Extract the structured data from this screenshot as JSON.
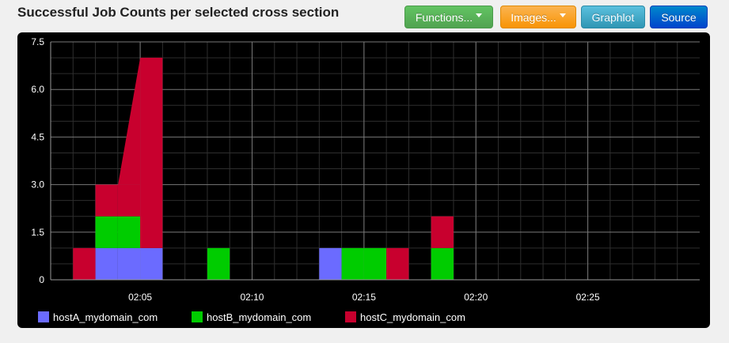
{
  "title": "Successful Job Counts per selected cross section",
  "toolbar": {
    "functions_label": "Functions...",
    "images_label": "Images...",
    "graphlot_label": "Graphlot",
    "source_label": "Source"
  },
  "chart_data": {
    "type": "area",
    "stacked": true,
    "x_unit": "time (minute buckets)",
    "x": [
      "02:02",
      "02:03",
      "02:04",
      "02:05",
      "02:06",
      "02:07",
      "02:08",
      "02:09",
      "02:10",
      "02:11",
      "02:12",
      "02:13",
      "02:14",
      "02:15",
      "02:16",
      "02:17",
      "02:18",
      "02:19"
    ],
    "series": [
      {
        "name": "hostA_mydomain_com",
        "color": "#6b6bff",
        "values": [
          0,
          1,
          1,
          1,
          0,
          0,
          0,
          0,
          0,
          0,
          0,
          1,
          0,
          0,
          0,
          0,
          0,
          0
        ]
      },
      {
        "name": "hostB_mydomain_com",
        "color": "#00cc00",
        "values": [
          0,
          1,
          1,
          0,
          0,
          0,
          1,
          0,
          0,
          0,
          0,
          0,
          1,
          1,
          0,
          0,
          1,
          0
        ]
      },
      {
        "name": "hostC_mydomain_com",
        "color": "#c8002e",
        "values": [
          1,
          1,
          1,
          6,
          0,
          0,
          0,
          0,
          0,
          0,
          0,
          0,
          0,
          0,
          1,
          0,
          1,
          0
        ]
      }
    ],
    "y_ticks": [
      "0",
      "1.5",
      "3.0",
      "4.5",
      "6.0",
      "7.5"
    ],
    "x_ticks": [
      "02:05",
      "02:10",
      "02:15",
      "02:20",
      "02:25"
    ],
    "ylim": [
      0,
      7.5
    ],
    "grid": true,
    "legend_position": "bottom-left"
  }
}
